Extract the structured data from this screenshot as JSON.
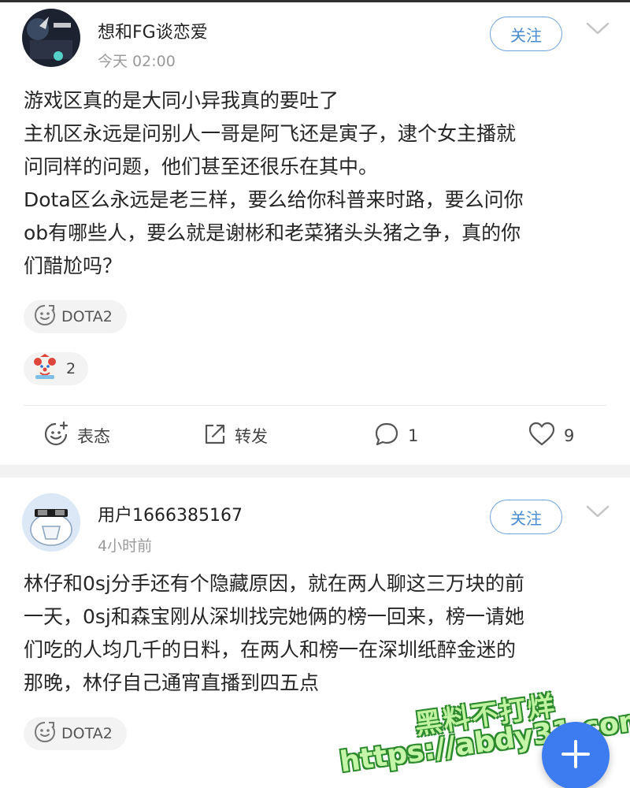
{
  "posts": [
    {
      "username": "想和FG谈恋爱",
      "time": "今天 02:00",
      "follow_label": "关注",
      "lines": [
        "游戏区真的是大同小异我真的要吐了",
        "主机区永远是问别人一哥是阿飞还是寅子，逮个女主播就",
        "问同样的问题，他们甚至还很乐在其中。",
        "Dota区么永远是老三样，要么给你科普来时路，要么问你",
        "ob有哪些人，要么就是谢彬和老菜猪头头猪之争，真的你",
        "们醋尬吗？"
      ],
      "tag": "DOTA2",
      "tag_icon": "smile-face-icon",
      "reaction_icon": "clown-icon",
      "reaction_count": "2",
      "actions": {
        "biaotai": "表态",
        "share": "转发",
        "comments": "1",
        "likes": "9"
      }
    },
    {
      "username": "用户1666385167",
      "time": "4小时前",
      "follow_label": "关注",
      "lines": [
        "林仔和0sj分手还有个隐藏原因，就在两人聊这三万块的前",
        "一天，0sj和森宝刚从深圳找完她俩的榜一回来，榜一请她",
        "们吃的人均几千的日料，在两人和榜一在深圳纸醉金迷的",
        "那晚，林仔自己通宵直播到四五点"
      ],
      "tag": "DOTA2",
      "tag_icon": "smile-face-icon"
    }
  ],
  "watermark": {
    "title": "黑料不打烊",
    "url": "https://abdy31.com"
  },
  "fab_icon": "plus-icon",
  "colors": {
    "accent": "#4a8cd0",
    "fab": "#3d7bf0",
    "separator": "#f2f2f2"
  }
}
